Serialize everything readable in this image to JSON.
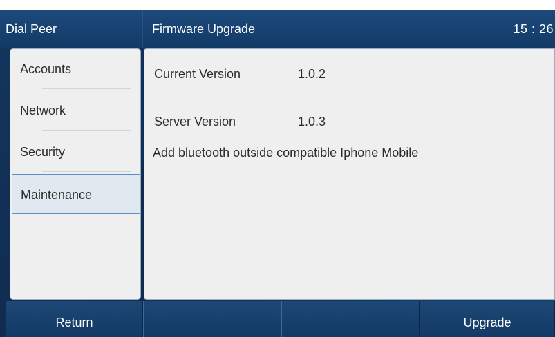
{
  "titlebar": {
    "left_title": "Dial Peer",
    "page_title": "Firmware Upgrade",
    "clock": "15 : 26"
  },
  "sidebar": {
    "items": [
      {
        "label": "Accounts"
      },
      {
        "label": "Network"
      },
      {
        "label": "Security"
      },
      {
        "label": "Maintenance",
        "active": true
      }
    ]
  },
  "content": {
    "current_version_label": "Current Version",
    "current_version_value": "1.0.2",
    "server_version_label": "Server Version",
    "server_version_value": "1.0.3",
    "release_note": "Add bluetooth outside compatible Iphone Mobile"
  },
  "softkeys": [
    {
      "label": "Return"
    },
    {
      "label": ""
    },
    {
      "label": ""
    },
    {
      "label": "Upgrade"
    }
  ],
  "colors": {
    "titlebar": "#123a66",
    "panel": "#efefef",
    "active_item": "#dfe9ef",
    "active_border": "#5a8fc4"
  }
}
